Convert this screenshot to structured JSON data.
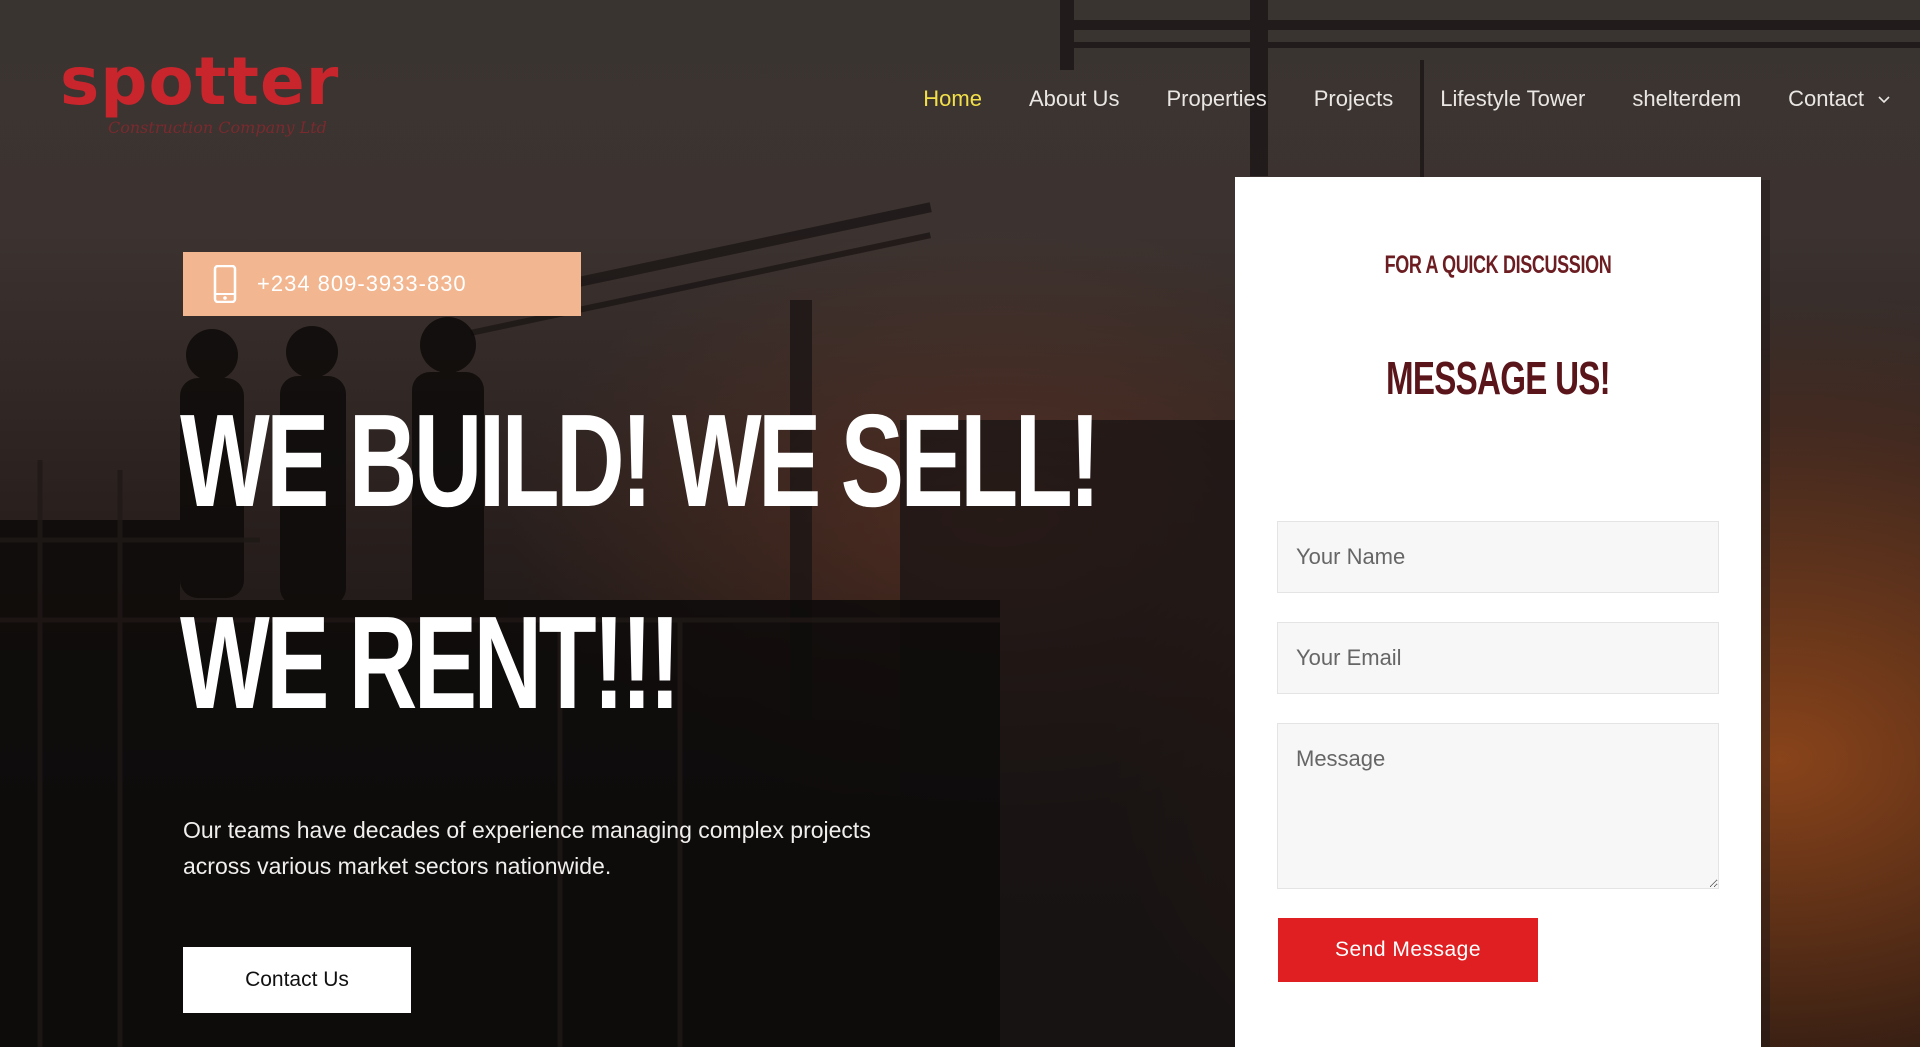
{
  "brand": {
    "logo_word": "spotter",
    "logo_tagline": "Construction Company Ltd"
  },
  "nav": {
    "items": [
      {
        "label": "Home",
        "active": true
      },
      {
        "label": "About Us"
      },
      {
        "label": "Properties"
      },
      {
        "label": "Projects"
      },
      {
        "label": "Lifestyle Tower"
      },
      {
        "label": "shelterdem"
      },
      {
        "label": "Contact",
        "has_dropdown": true
      }
    ]
  },
  "hero": {
    "phone": "+234 809-3933-830",
    "headline_line1": "WE BUILD! WE SELL!",
    "headline_line2": "WE RENT!!!",
    "lead_line1": "Our teams have decades of experience managing complex projects",
    "lead_line2": "across various market sectors nationwide.",
    "cta_label": "Contact Us"
  },
  "form": {
    "kicker": "FOR A QUICK DISCUSSION",
    "title": "MESSAGE US!",
    "name_placeholder": "Your Name",
    "email_placeholder": "Your Email",
    "message_placeholder": "Message",
    "submit_label": "Send Message"
  },
  "colors": {
    "accent_red": "#e01f22",
    "nav_active": "#f2e04a",
    "phone_pill": "#f2b690",
    "form_heading": "#5a151a"
  },
  "icons": [
    "phone-icon",
    "chevron-down-icon"
  ]
}
